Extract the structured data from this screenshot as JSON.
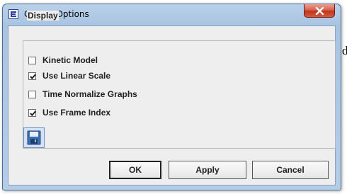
{
  "background_text": "d",
  "window": {
    "title": "Curves Options",
    "close_icon": "close-icon"
  },
  "display_group": {
    "legend": "Display",
    "options": [
      {
        "label": "Kinetic Model",
        "checked": false
      },
      {
        "label": "Use Linear Scale",
        "checked": true
      },
      {
        "label": "Time Normalize Graphs",
        "checked": false
      },
      {
        "label": "Use Frame Index",
        "checked": true
      }
    ]
  },
  "toolbar": {
    "save_icon": "save-icon"
  },
  "buttons": {
    "ok": "OK",
    "apply": "Apply",
    "cancel": "Cancel"
  }
}
